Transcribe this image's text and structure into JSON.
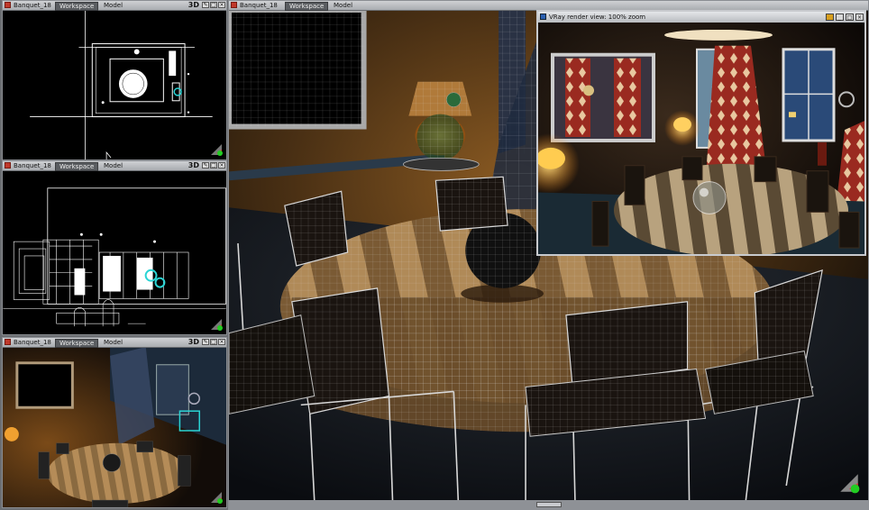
{
  "viewports": {
    "top": {
      "title": "Banquet_18",
      "tab_workspace": "Workspace",
      "tab_model": "Model",
      "mode": "3D"
    },
    "front": {
      "title": "Banquet_18",
      "tab_workspace": "Workspace",
      "tab_model": "Model",
      "mode": "3D"
    },
    "persp": {
      "title": "Banquet_18",
      "tab_workspace": "Workspace",
      "tab_model": "Model",
      "mode": "3D"
    },
    "main": {
      "title": "Banquet_18",
      "tab_workspace": "Workspace",
      "tab_model": "Model"
    }
  },
  "render_window": {
    "title": "VRay render view: 100% zoom"
  },
  "icons": {
    "header": "app-icon",
    "min": "minimize-icon",
    "max": "maximize-icon",
    "close": "close-icon",
    "gizmo": "axis-gizmo-icon"
  },
  "colors": {
    "titlebar": "#c0c3c7",
    "workspace_tab": "#5a5d61",
    "viewport_bg": "#000000",
    "wire": "#ffffff"
  }
}
